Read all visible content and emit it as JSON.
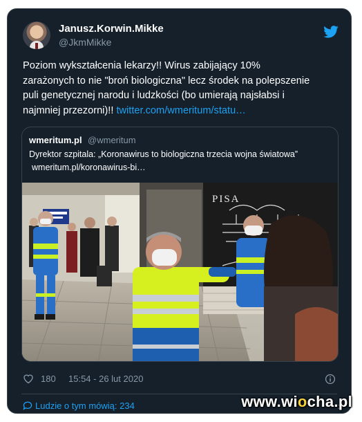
{
  "author": {
    "name": "Janusz.Korwin.Mikke",
    "handle": "@JkmMikke"
  },
  "tweet": {
    "text_line1": "Poziom wykształcenia lekarzy!! Wirus zabijający 10%",
    "text_line2": "zarażonych to nie \"broń biologiczna\" lecz środek na polepszenie",
    "text_line3": "puli genetycznej narodu i ludzkości (bo umierają najsłabsi i",
    "text_line4_plain": "najmniej przezorni)!! ",
    "link": "twitter.com/wmeritum/statu…"
  },
  "quote_card": {
    "domain": "wmeritum.pl",
    "handle": "@wmeritum",
    "description": "Dyrektor szpitala: „Koronawirus to biologiczna trzecia wojna światowa”",
    "link": "wmeritum.pl/koronawirus-bi…",
    "photo_sign_text": "PISA"
  },
  "footer": {
    "likes": "180",
    "timestamp": "15:54 - 26 lut 2020",
    "conversation_label": "Ludzie o tym mówią: 234"
  },
  "watermark": {
    "prefix": "www.wi",
    "o": "o",
    "suffix": "cha.pl"
  },
  "colors": {
    "background": "#15202b",
    "accent": "#1da1f2",
    "muted": "#8899a6",
    "border": "#38444d"
  },
  "icons": [
    "twitter-bird-icon",
    "heart-icon",
    "info-icon",
    "speech-bubble-icon",
    "chevron-right-icon"
  ]
}
